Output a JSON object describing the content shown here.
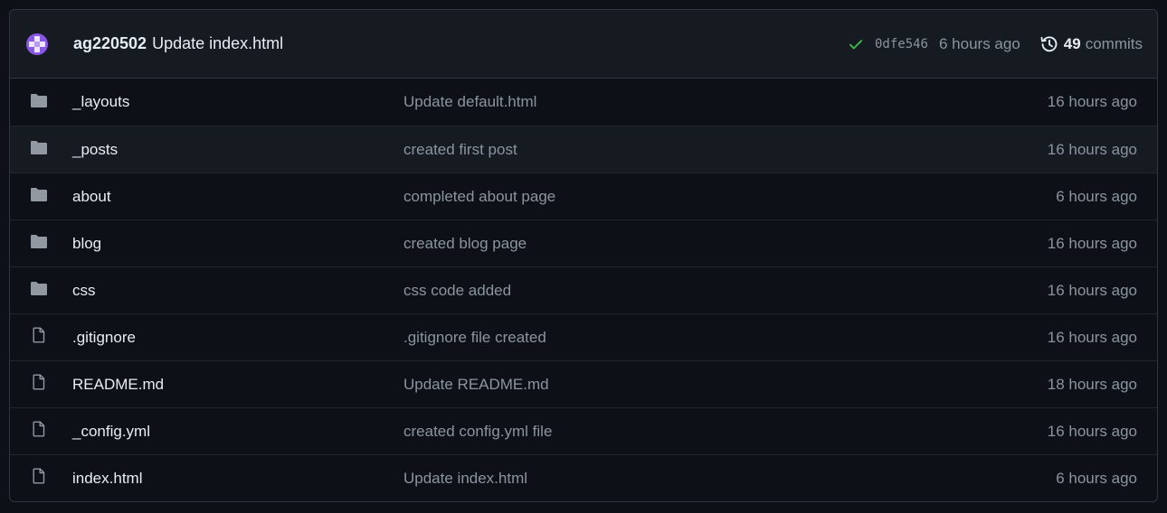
{
  "latest_commit": {
    "author": "ag220502",
    "message": "Update index.html",
    "status": "success",
    "status_color": "#3fb950",
    "sha": "0dfe546",
    "age": "6 hours ago",
    "commit_count": "49",
    "commits_label": "commits"
  },
  "files": [
    {
      "icon": "folder-icon",
      "name": "_layouts",
      "message": "Update default.html",
      "age": "16 hours ago"
    },
    {
      "icon": "folder-icon",
      "name": "_posts",
      "message": "created first post",
      "age": "16 hours ago"
    },
    {
      "icon": "folder-icon",
      "name": "about",
      "message": "completed about page",
      "age": "6 hours ago"
    },
    {
      "icon": "folder-icon",
      "name": "blog",
      "message": "created blog page",
      "age": "16 hours ago"
    },
    {
      "icon": "folder-icon",
      "name": "css",
      "message": "css code added",
      "age": "16 hours ago"
    },
    {
      "icon": "file-icon",
      "name": ".gitignore",
      "message": ".gitignore file created",
      "age": "16 hours ago"
    },
    {
      "icon": "file-icon",
      "name": "README.md",
      "message": "Update README.md",
      "age": "18 hours ago"
    },
    {
      "icon": "file-icon",
      "name": "_config.yml",
      "message": "created config.yml file",
      "age": "16 hours ago"
    },
    {
      "icon": "file-icon",
      "name": "index.html",
      "message": "Update index.html",
      "age": "6 hours ago"
    }
  ]
}
